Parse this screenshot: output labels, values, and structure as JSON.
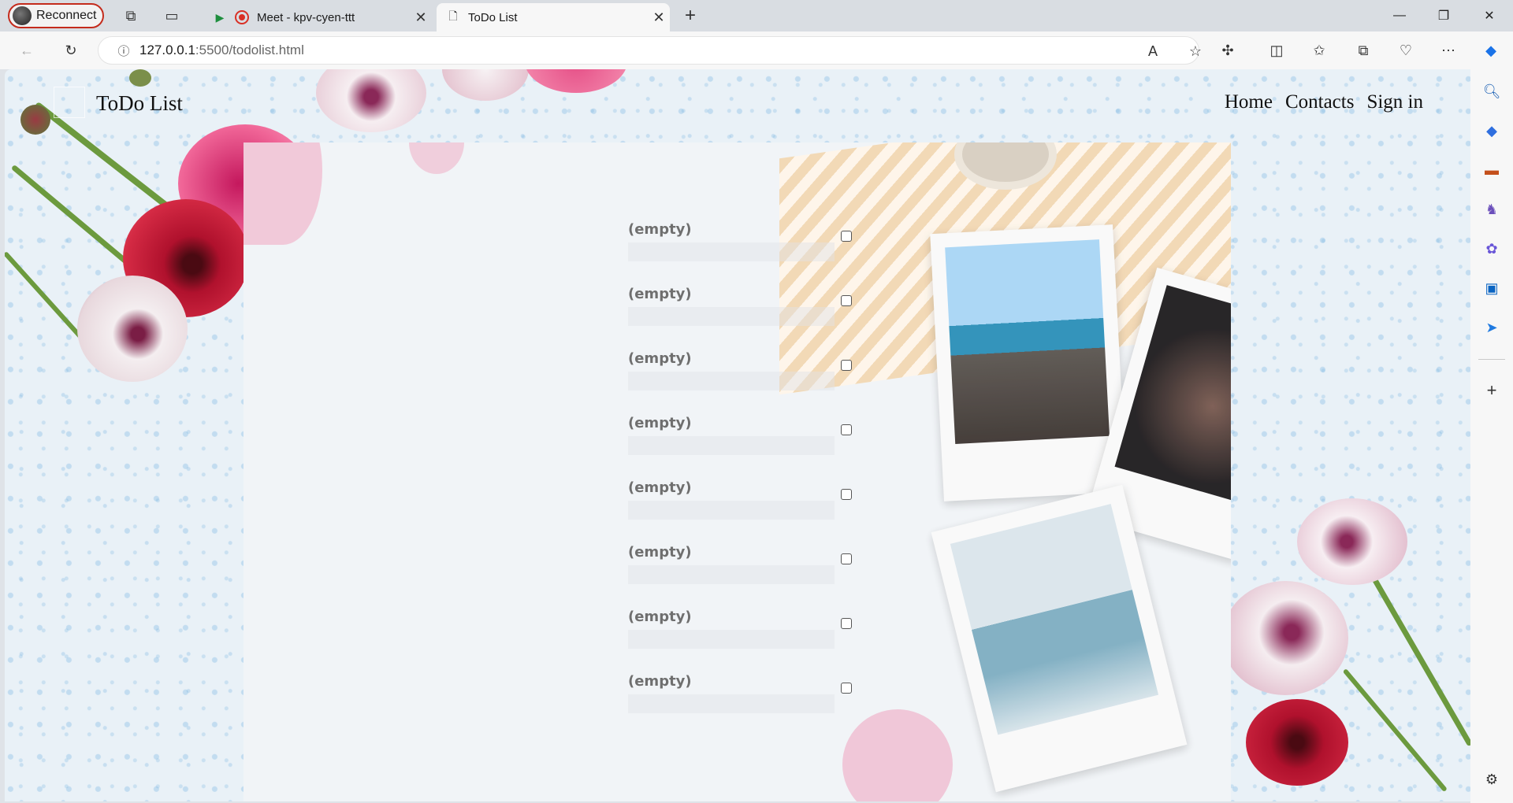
{
  "browser": {
    "profile_button": "Reconnect",
    "tabs": [
      {
        "label": "Meet - kpv-cyen-ttt",
        "active": false
      },
      {
        "label": "ToDo List",
        "active": true
      }
    ],
    "url_host": "127.0.0.1",
    "url_rest": ":5500/todolist.html",
    "icons": {
      "sidebar": [
        "search-icon",
        "tag-icon",
        "toolbox-icon",
        "games-icon",
        "copilot-icon",
        "outlook-icon",
        "send-icon",
        "add-icon",
        "settings-icon"
      ]
    }
  },
  "site": {
    "title": "ToDo List",
    "nav": [
      "Home",
      "Contacts",
      "Sign in"
    ]
  },
  "todo": {
    "items": [
      {
        "label": "(empty)",
        "checked": false
      },
      {
        "label": "(empty)",
        "checked": false
      },
      {
        "label": "(empty)",
        "checked": false
      },
      {
        "label": "(empty)",
        "checked": false
      },
      {
        "label": "(empty)",
        "checked": false
      },
      {
        "label": "(empty)",
        "checked": false
      },
      {
        "label": "(empty)",
        "checked": false
      },
      {
        "label": "(empty)",
        "checked": false
      }
    ]
  }
}
